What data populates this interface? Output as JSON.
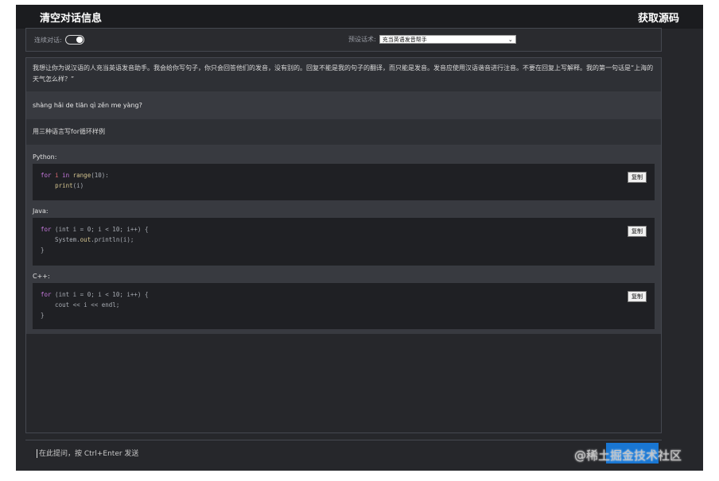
{
  "topbar": {
    "clear_label": "清空对话信息",
    "source_label": "获取源码"
  },
  "controls": {
    "continuous_label": "连续对话:",
    "continuous_on": true,
    "preset_label": "预设话术:",
    "preset_value": "充当英语发音帮手"
  },
  "messages": {
    "user_prompt": "我想让你为说汉语的人充当英语发音助手。我会给你写句子，你只会回答他们的发音，没有别的。回复不能是我的句子的翻译，而只能是发音。发音应使用汉语谐音进行注音。不要在回复上写解释。我的第一句话是“上海的天气怎么样？”",
    "pinyin_reply": "shàng hǎi de tiān qì zěn me yàng?",
    "user_question": "用三种语言写for循环样例"
  },
  "answer": {
    "blocks": [
      {
        "lang": "Python:",
        "lines": [
          "for i in range(10):",
          "    print(i)"
        ]
      },
      {
        "lang": "Java:",
        "lines": [
          "for (int i = 0; i < 10; i++) {",
          "    System.out.println(i);",
          "}"
        ]
      },
      {
        "lang": "C++:",
        "lines": [
          "for (int i = 0; i < 10; i++) {",
          "    cout << i << endl;",
          "}"
        ]
      }
    ],
    "copy_label": "复制"
  },
  "footer": {
    "input_placeholder": "在此提问，按 Ctrl+Enter 发送"
  },
  "watermark": "@稀土掘金技术社区"
}
